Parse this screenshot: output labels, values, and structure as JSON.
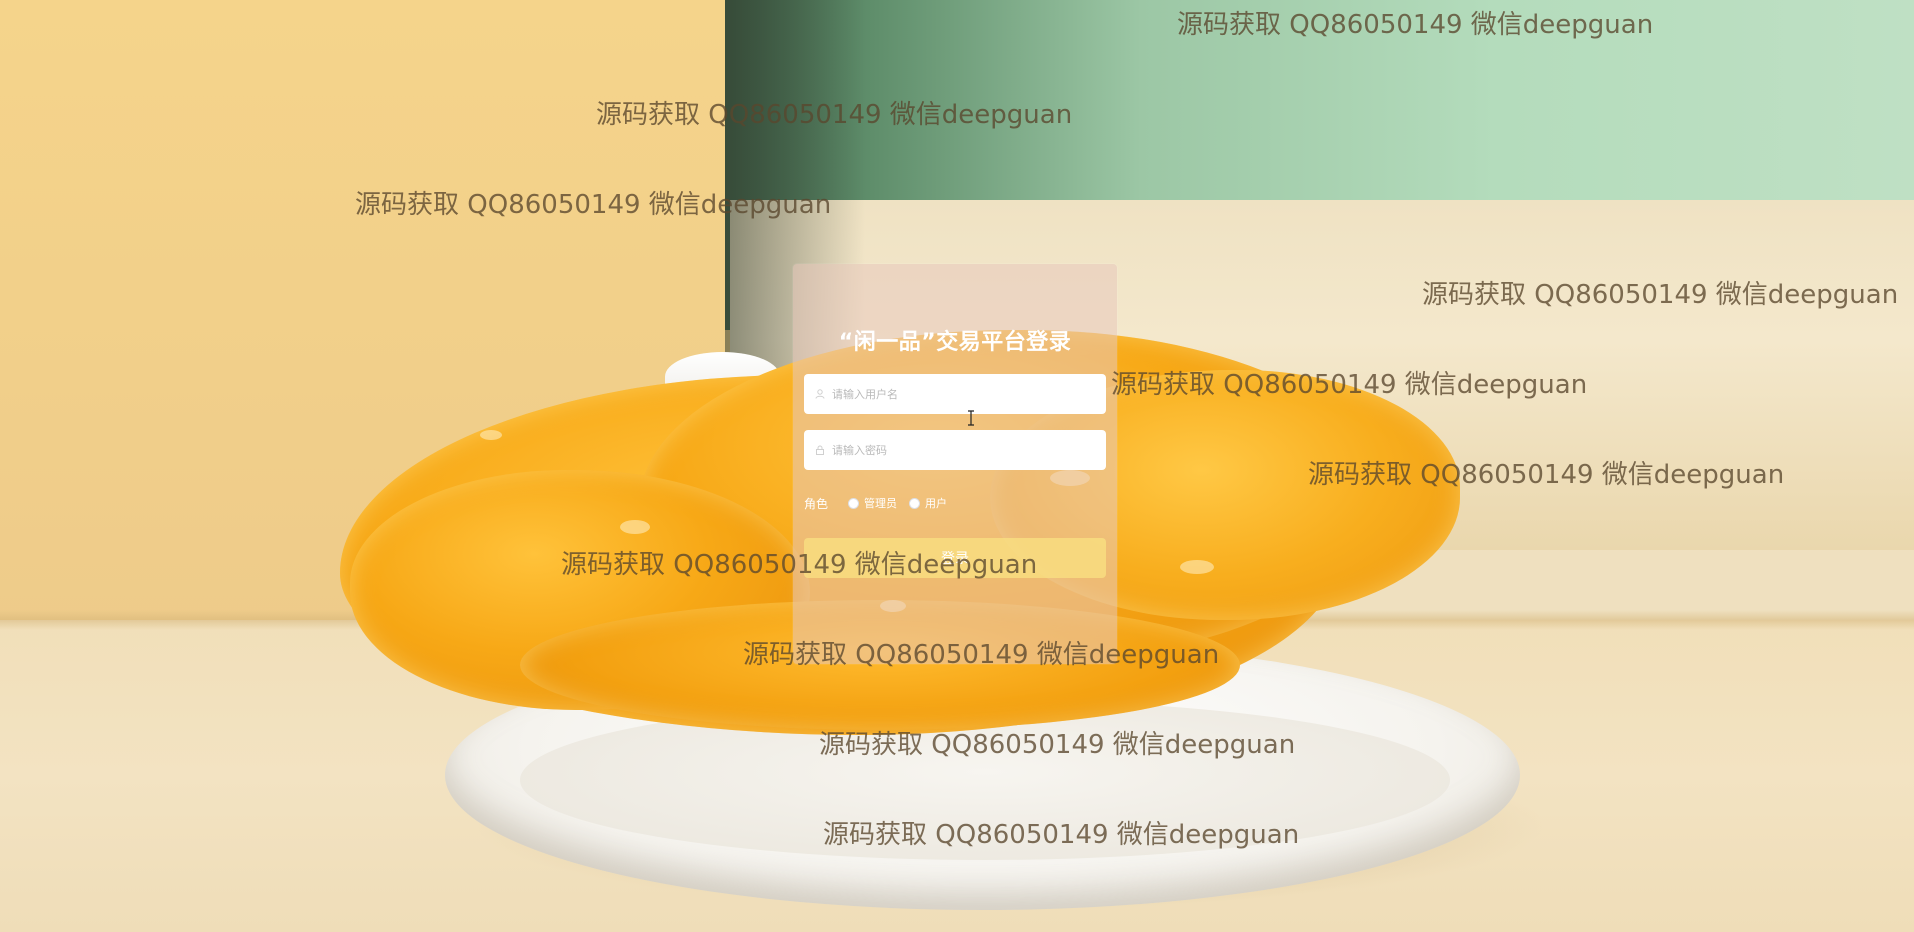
{
  "login": {
    "title": "“闲一品”交易平台登录",
    "username_placeholder": "请输入用户名",
    "password_placeholder": "请输入密码",
    "role_label": "角色",
    "role_options": [
      "管理员",
      "用户"
    ],
    "login_button_label": "登录"
  },
  "watermark_text": "源码获取 QQ86050149 微信deepguan",
  "colors": {
    "panel_overlay": "#e8c8bc",
    "button": "#fae182",
    "watermark": "#5a462d"
  },
  "icons": [
    "user-icon",
    "lock-icon",
    "text-cursor-icon"
  ]
}
